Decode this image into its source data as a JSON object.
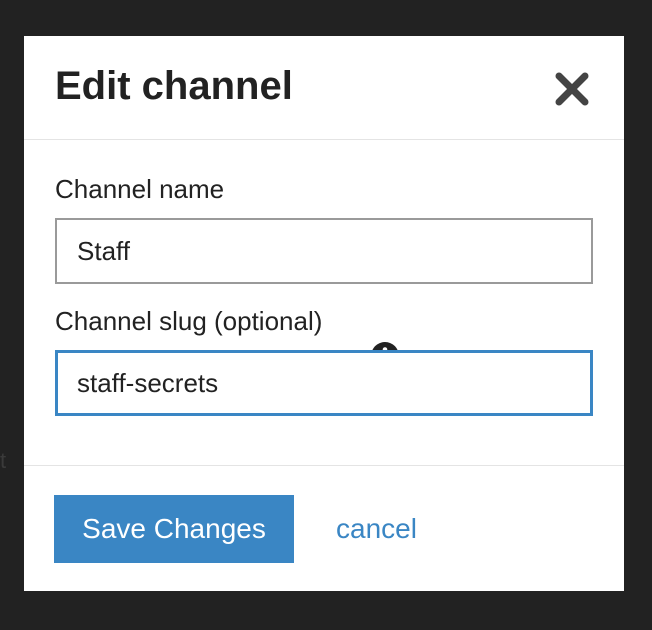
{
  "modal": {
    "title": "Edit channel"
  },
  "fields": {
    "name_label": "Channel name",
    "name_value": "Staff",
    "slug_label": "Channel slug (optional)",
    "slug_value": "staff-secrets"
  },
  "footer": {
    "save_label": "Save Changes",
    "cancel_label": "cancel"
  },
  "backdrop": {
    "partial_text": "t"
  },
  "icons": {
    "close": "close-icon",
    "info": "info-icon"
  },
  "colors": {
    "accent": "#3a86c4",
    "backdrop": "#222222",
    "text": "#222222"
  }
}
